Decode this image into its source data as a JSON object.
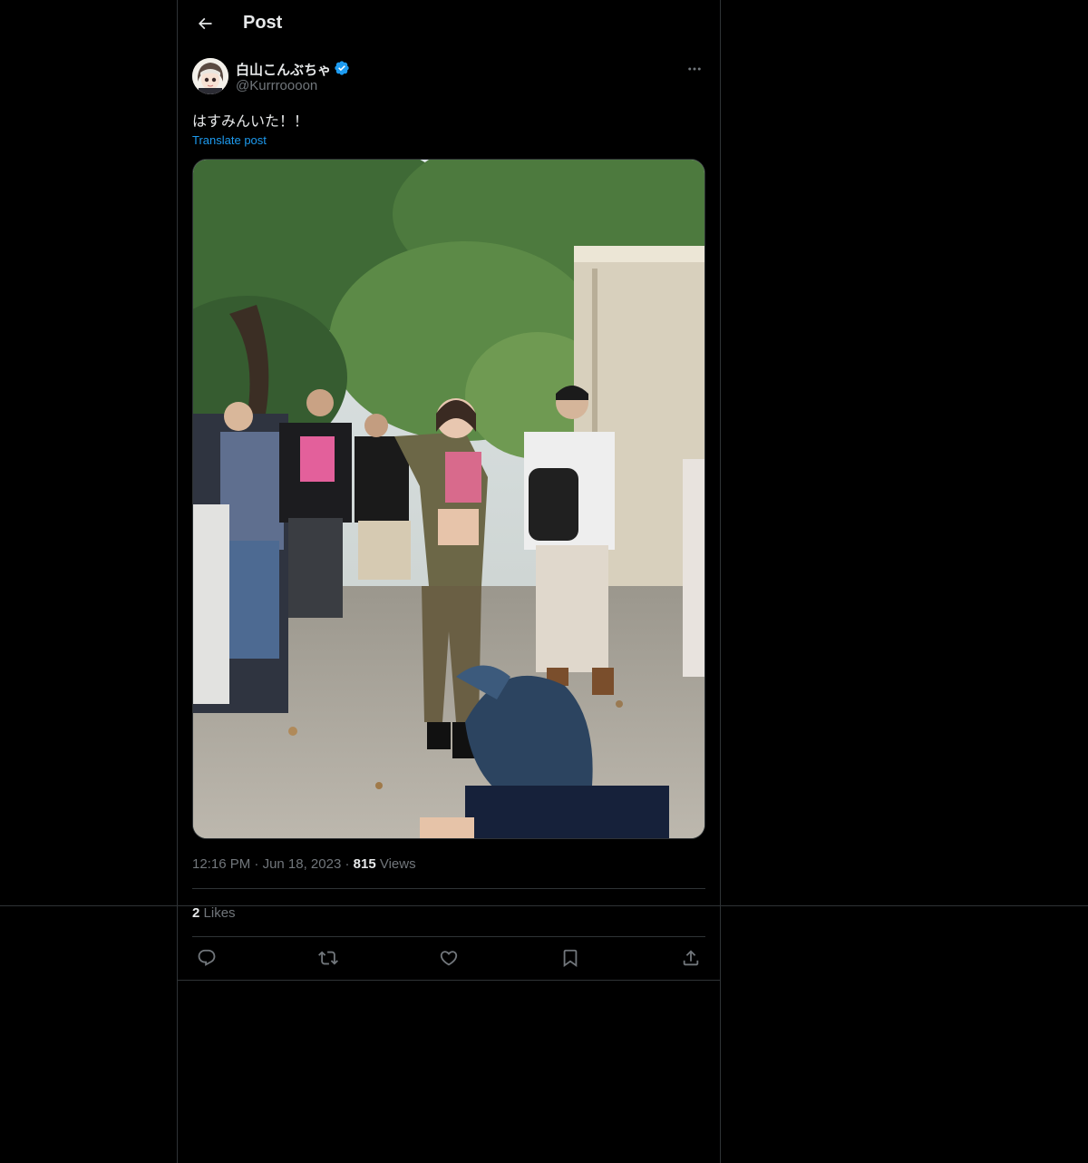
{
  "header": {
    "title": "Post"
  },
  "author": {
    "display_name": "白山こんぶちゃ",
    "handle": "@Kurrroooon",
    "verified": true
  },
  "post": {
    "text": "はすみんいた！！",
    "translate_label": "Translate post",
    "time": "12:16 PM",
    "date": "Jun 18, 2023",
    "views_count": "815",
    "views_label": "Views",
    "likes_count": "2",
    "likes_label": "Likes"
  },
  "colors": {
    "background": "#000000",
    "border": "#2f3336",
    "text_primary": "#e7e9ea",
    "text_secondary": "#71767b",
    "accent": "#1d9bf0"
  },
  "icons": {
    "back": "arrow-left-icon",
    "more": "more-horizontal-icon",
    "verified": "verified-badge-icon",
    "reply": "reply-icon",
    "repost": "repost-icon",
    "like": "heart-icon",
    "bookmark": "bookmark-icon",
    "share": "share-icon"
  }
}
